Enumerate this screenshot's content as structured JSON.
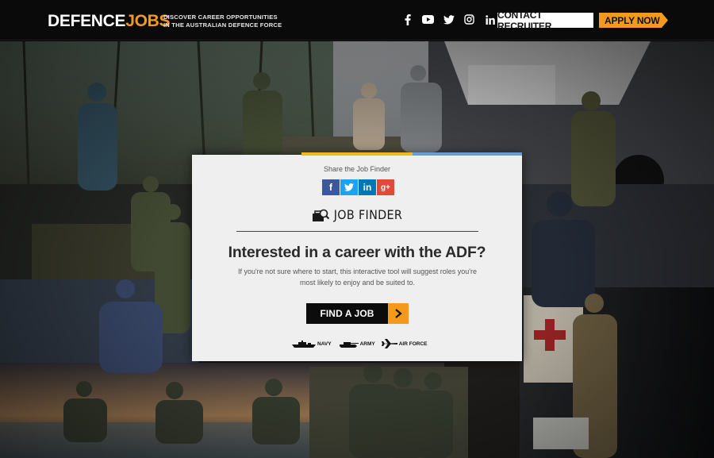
{
  "header": {
    "logo_part1": "DEFENCE",
    "logo_part2": "JOBS",
    "tagline_line1": "DISCOVER CAREER OPPORTUNITIES",
    "tagline_line2": "IN THE AUSTRALIAN DEFENCE FORCE",
    "social_icons": [
      "facebook-icon",
      "youtube-icon",
      "twitter-icon",
      "instagram-icon",
      "linkedin-icon"
    ],
    "contact_label": "CONTACT RECRUITER",
    "apply_label": "APPLY NOW"
  },
  "modal": {
    "share_label": "Share the Job Finder",
    "share_buttons": [
      "f",
      "t",
      "in",
      "g+"
    ],
    "title": "JOB FINDER",
    "headline": "Interested in a career with the ADF?",
    "description": "If you're not sure where to start, this interactive tool will suggest roles you're most likely to enjoy and be suited to.",
    "cta_label": "FIND A JOB",
    "services": [
      "NAVY",
      "ARMY",
      "AIR FORCE"
    ]
  },
  "colors": {
    "accent_orange": "#f39a1e",
    "header_bg": "#0a0a0a",
    "modal_bg": "#efefef",
    "stripe_yellow": "#f2b71f",
    "stripe_blue": "#6c9bd2"
  }
}
